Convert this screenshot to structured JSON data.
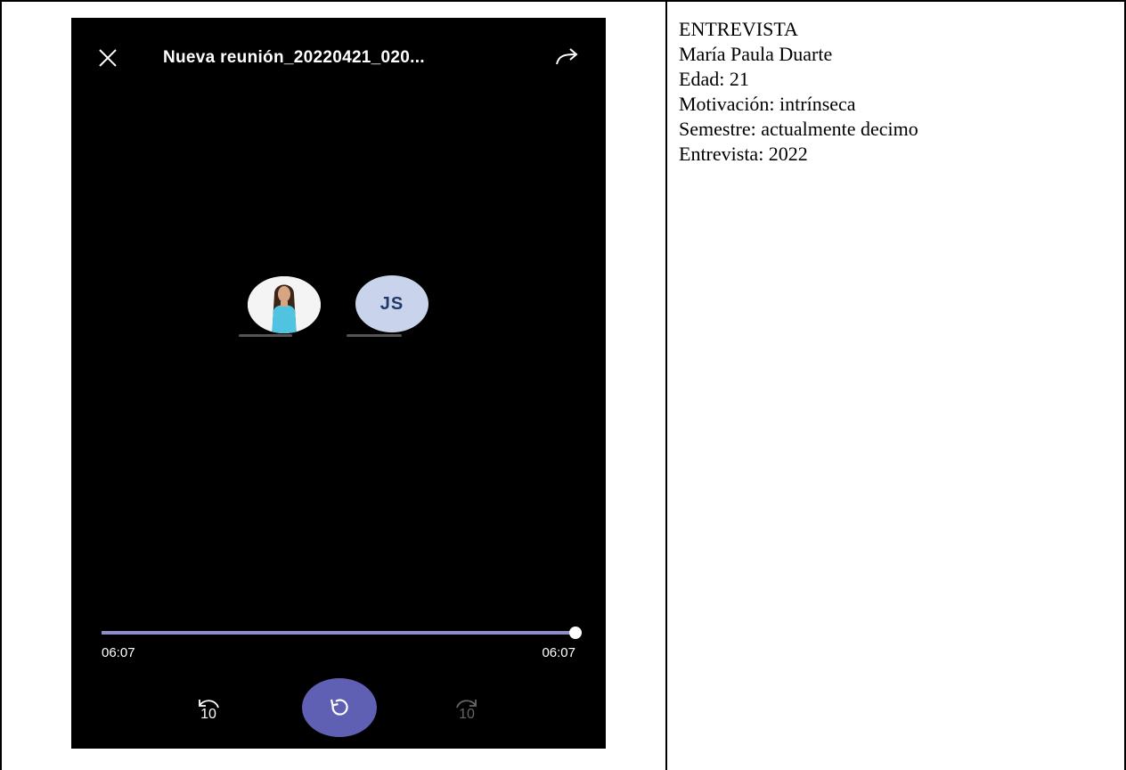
{
  "recording": {
    "title": "Nueva reunión_20220421_020...",
    "elapsed": "06:07",
    "duration": "06:07",
    "progress_fraction": 1.0,
    "skip_back_label": "10",
    "skip_forward_label": "10",
    "participant_initials": "JS",
    "icons": [
      "close-icon",
      "share-forward-icon",
      "rewind-10-icon",
      "replay-icon",
      "forward-10-icon"
    ],
    "colors": {
      "accent": "#5f5fb4",
      "background": "#000000",
      "initials_avatar": "#c9d4ec"
    }
  },
  "interview": {
    "heading": "ENTREVISTA",
    "name": "María Paula Duarte",
    "age": "Edad: 21",
    "motivation": "Motivación: intrínseca",
    "semester": "Semestre: actualmente decimo",
    "year": "Entrevista: 2022"
  }
}
